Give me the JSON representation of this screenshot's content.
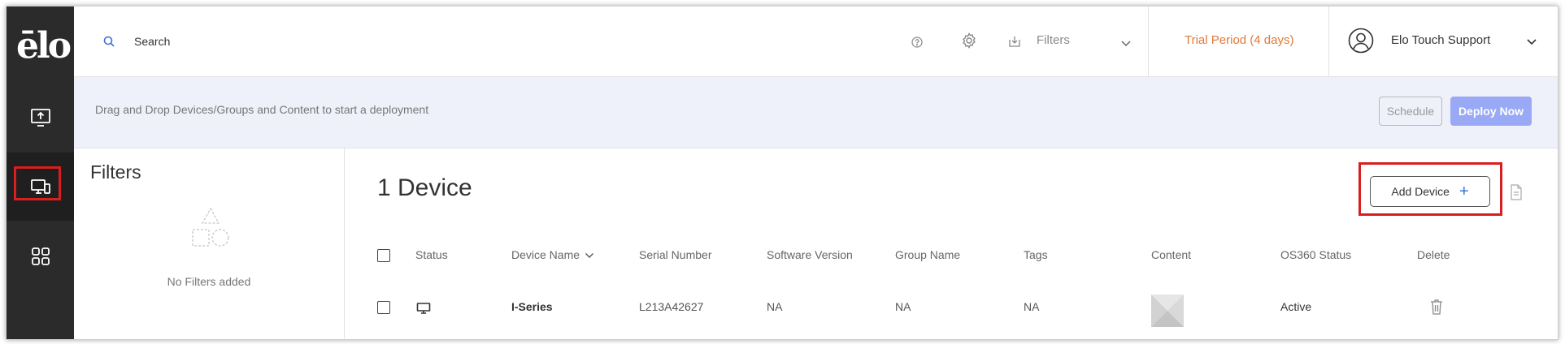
{
  "app": {
    "logo_text": "ēlo"
  },
  "sidebar": {
    "items": [
      {
        "name": "deploy",
        "icon": "upload-screen-icon"
      },
      {
        "name": "devices",
        "icon": "devices-icon",
        "active": true
      },
      {
        "name": "apps",
        "icon": "grid-icon"
      }
    ]
  },
  "topbar": {
    "search_placeholder": "Search",
    "filters_label": "Filters",
    "trial_label": "Trial Period (4 days)",
    "user_name": "Elo Touch Support"
  },
  "deploybar": {
    "instruction": "Drag and Drop Devices/Groups and Content to start a deployment",
    "schedule_label": "Schedule",
    "deploy_label": "Deploy Now"
  },
  "filters_panel": {
    "title": "Filters",
    "empty_text": "No Filters added"
  },
  "main": {
    "device_count_label": "1 Device",
    "add_device_label": "Add Device",
    "columns": [
      "Status",
      "Device Name",
      "Serial Number",
      "Software Version",
      "Group Name",
      "Tags",
      "Content",
      "OS360 Status",
      "Delete"
    ],
    "rows": [
      {
        "status_icon": "monitor-icon",
        "device_name": "I-Series",
        "serial_number": "L213A42627",
        "software_version": "NA",
        "group_name": "NA",
        "tags": "NA",
        "content": "thumbnail",
        "os360_status": "Active"
      }
    ]
  },
  "colors": {
    "sidebar_bg": "#2b2b2b",
    "trial_accent": "#e07b39",
    "deploy_button": "#9aa9f5",
    "highlight_red": "#d81e1e",
    "deploybar_bg": "#eef1fa"
  }
}
